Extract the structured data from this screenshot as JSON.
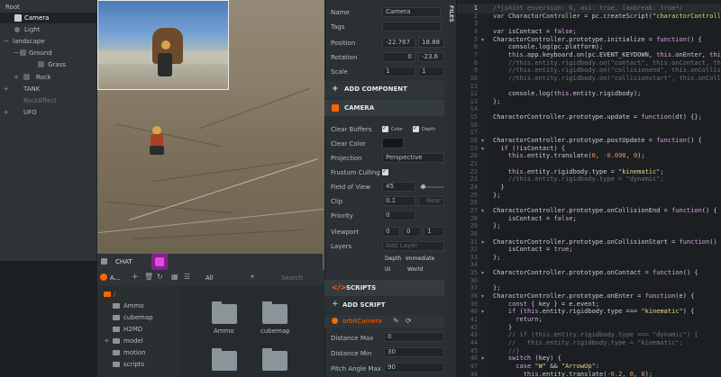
{
  "hierarchy": {
    "items": [
      {
        "label": "Root"
      },
      {
        "label": "Camera"
      },
      {
        "label": "Light"
      },
      {
        "label": "landscape"
      },
      {
        "label": "Ground"
      },
      {
        "label": "Grass"
      },
      {
        "label": "Rock"
      },
      {
        "label": "TANK"
      },
      {
        "label": "RockEffect"
      },
      {
        "label": "UFO"
      }
    ]
  },
  "viewport": {
    "chat_label": "CHAT"
  },
  "assets": {
    "panel_label": "A...",
    "filter_label": "All",
    "search_placeholder": "Search",
    "tree": [
      {
        "label": "/"
      },
      {
        "label": "Ammo"
      },
      {
        "label": "cubemap"
      },
      {
        "label": "H2MD"
      },
      {
        "label": "model"
      },
      {
        "label": "motion"
      },
      {
        "label": "scripts"
      }
    ],
    "grid": [
      {
        "label": "Ammo"
      },
      {
        "label": "cubemap"
      },
      {
        "label": ""
      },
      {
        "label": ""
      }
    ]
  },
  "inspector": {
    "entity": {
      "name_label": "Name",
      "name_value": "Camera",
      "tags_label": "Tags",
      "position_label": "Position",
      "position": [
        "-22.767",
        "18.88"
      ],
      "rotation_label": "Rotation",
      "rotation": [
        "0",
        "-23.6"
      ],
      "scale_label": "Scale",
      "scale": [
        "1",
        "1"
      ]
    },
    "add_component": "ADD COMPONENT",
    "camera": {
      "title": "CAMERA",
      "clear_buffers_label": "Clear Buffers",
      "color_label": "Color",
      "depth_label": "Depth",
      "clear_color_label": "Clear Color",
      "projection_label": "Projection",
      "projection_value": "Perspective",
      "frustum_label": "Frustum Culling",
      "fov_label": "Field of View",
      "fov_value": "45",
      "clip_label": "Clip",
      "clip_near": "0.1",
      "clip_far_ph": "Near",
      "priority_label": "Priority",
      "priority_value": "0",
      "viewport_label": "Viewport",
      "viewport": [
        "0",
        "0",
        "1"
      ],
      "layers_label": "Layers",
      "add_layer_ph": "Add Layer",
      "layers": [
        "Depth",
        "Immediate",
        "UI",
        "World"
      ]
    },
    "scripts": {
      "title": "SCRIPTS",
      "add_script": "ADD SCRIPT",
      "script_name": "orbitCamera",
      "distance_max_label": "Distance Max",
      "distance_max": "0",
      "distance_min_label": "Distance Min",
      "distance_min": "30",
      "pitch_max_label": "Pitch Angle Max ...",
      "pitch_max": "90"
    }
  },
  "editor": {
    "files_tab": "FILES",
    "lines": [
      "/*jshint esversion: 6, asi: true, laxbreak: true*/",
      "var CharactorController = pc.createScript(\"charactorController\");",
      "",
      "var isContact = false;",
      "CharactorController.prototype.initialize = function() {",
      "    console.log(pc.platform);",
      "    this.app.keyboard.on(pc.EVENT_KEYDOWN, this.onEnter, this);",
      "    //this.entity.rigidbody.on(\"contact\", this.onContact, this);",
      "    //this.entity.rigidbody.on(\"collisionend\", this.onCollisionEnd",
      "    //this.entity.rigidbody.on(\"collisionstart\", this.onCollisionS",
      "",
      "    console.log(this.entity.rigidbody);",
      "};",
      "",
      "CharactorController.prototype.update = function(dt) {};",
      "",
      "",
      "CharactorController.prototype.postUpdate = function() {",
      "  if (!isContact) {",
      "    this.entity.translate(0, -0.098, 0);",
      "",
      "    this.entity.rigidbody.type = \"kinematic\";",
      "    //this.entity.rigidbody.type = \"dynamic\";",
      "  }",
      "};",
      "",
      "CharactorController.prototype.onCollisionEnd = function() {",
      "    isContact = false;",
      "};",
      "",
      "CharactorController.prototype.onCollisionStart = function() {",
      "    isContact = true;",
      "};",
      "",
      "CharactorController.prototype.onContact = function() {",
      "",
      "};",
      "CharactorController.prototype.onEnter = function(e) {",
      "    const { key } = e.event;",
      "    if (this.entity.rigidbody.type === \"kinematic\") {",
      "      return;",
      "    }",
      "    // if (this.entity.rigidbody.type === \"dynamic\") {",
      "    //   this.entity.rigidbody.type = \"kinematic\";",
      "    //}",
      "    switch (key) {",
      "      case \"W\" && \"ArrowUp\":",
      "        this.entity.translate(-0.2, 0, 0);"
    ]
  },
  "colors": {
    "accent": "#ff6600",
    "selection": "#1f2326",
    "keyword": "#d6a4e6",
    "string": "#e6d88a",
    "number": "#ff8b5e",
    "comment": "#6b7579"
  }
}
